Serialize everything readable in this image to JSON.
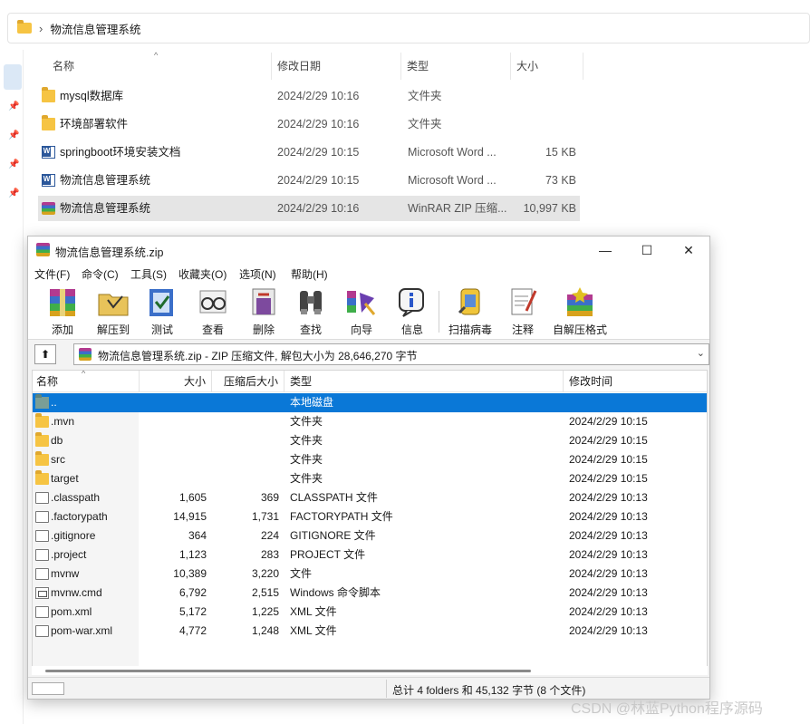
{
  "explorer": {
    "breadcrumb": "物流信息管理系统",
    "columns": {
      "name": "名称",
      "date": "修改日期",
      "type": "类型",
      "size": "大小"
    },
    "rows": [
      {
        "name": "mysql数据库",
        "date": "2024/2/29 10:16",
        "type": "文件夹",
        "size": "",
        "icon": "folder-icon"
      },
      {
        "name": "环境部署软件",
        "date": "2024/2/29 10:16",
        "type": "文件夹",
        "size": "",
        "icon": "folder-icon"
      },
      {
        "name": "springboot环境安装文档",
        "date": "2024/2/29 10:15",
        "type": "Microsoft Word ...",
        "size": "15 KB",
        "icon": "word-doc-icon"
      },
      {
        "name": "物流信息管理系统",
        "date": "2024/2/29 10:15",
        "type": "Microsoft Word ...",
        "size": "73 KB",
        "icon": "word-doc-icon"
      },
      {
        "name": "物流信息管理系统",
        "date": "2024/2/29 10:16",
        "type": "WinRAR ZIP 压缩...",
        "size": "10,997 KB",
        "icon": "winrar-archive-icon"
      }
    ]
  },
  "winrar": {
    "title": "物流信息管理系统.zip",
    "window_buttons": {
      "minimize": "—",
      "maximize": "☐",
      "close": "✕"
    },
    "menu": [
      "文件(F)",
      "命令(C)",
      "工具(S)",
      "收藏夹(O)",
      "选项(N)",
      "帮助(H)"
    ],
    "toolbar": [
      "添加",
      "解压到",
      "测试",
      "查看",
      "删除",
      "查找",
      "向导",
      "信息",
      "扫描病毒",
      "注释",
      "自解压格式"
    ],
    "path": "物流信息管理系统.zip - ZIP 压缩文件, 解包大小为 28,646,270 字节",
    "list_columns": {
      "name": "名称",
      "size": "大小",
      "packed": "压缩后大小",
      "type": "类型",
      "modified": "修改时间"
    },
    "list_rows": [
      {
        "name": "..",
        "size": "",
        "packed": "",
        "type": "本地磁盘",
        "modified": "",
        "icon": "parent-folder-icon"
      },
      {
        "name": ".mvn",
        "size": "",
        "packed": "",
        "type": "文件夹",
        "modified": "2024/2/29 10:15",
        "icon": "folder-icon"
      },
      {
        "name": "db",
        "size": "",
        "packed": "",
        "type": "文件夹",
        "modified": "2024/2/29 10:15",
        "icon": "folder-icon"
      },
      {
        "name": "src",
        "size": "",
        "packed": "",
        "type": "文件夹",
        "modified": "2024/2/29 10:15",
        "icon": "folder-icon"
      },
      {
        "name": "target",
        "size": "",
        "packed": "",
        "type": "文件夹",
        "modified": "2024/2/29 10:15",
        "icon": "folder-icon"
      },
      {
        "name": ".classpath",
        "size": "1,605",
        "packed": "369",
        "type": "CLASSPATH 文件",
        "modified": "2024/2/29 10:13",
        "icon": "file-icon"
      },
      {
        "name": ".factorypath",
        "size": "14,915",
        "packed": "1,731",
        "type": "FACTORYPATH 文件",
        "modified": "2024/2/29 10:13",
        "icon": "file-icon"
      },
      {
        "name": ".gitignore",
        "size": "364",
        "packed": "224",
        "type": "GITIGNORE 文件",
        "modified": "2024/2/29 10:13",
        "icon": "file-icon"
      },
      {
        "name": ".project",
        "size": "1,123",
        "packed": "283",
        "type": "PROJECT 文件",
        "modified": "2024/2/29 10:13",
        "icon": "file-icon"
      },
      {
        "name": "mvnw",
        "size": "10,389",
        "packed": "3,220",
        "type": "文件",
        "modified": "2024/2/29 10:13",
        "icon": "file-icon"
      },
      {
        "name": "mvnw.cmd",
        "size": "6,792",
        "packed": "2,515",
        "type": "Windows 命令脚本",
        "modified": "2024/2/29 10:13",
        "icon": "cmd-script-icon"
      },
      {
        "name": "pom.xml",
        "size": "5,172",
        "packed": "1,225",
        "type": "XML 文件",
        "modified": "2024/2/29 10:13",
        "icon": "file-icon"
      },
      {
        "name": "pom-war.xml",
        "size": "4,772",
        "packed": "1,248",
        "type": "XML 文件",
        "modified": "2024/2/29 10:13",
        "icon": "file-icon"
      }
    ],
    "status": "总计 4 folders 和 45,132 字节 (8 个文件)"
  },
  "watermark": "CSDN @林蓝Python程序源码"
}
